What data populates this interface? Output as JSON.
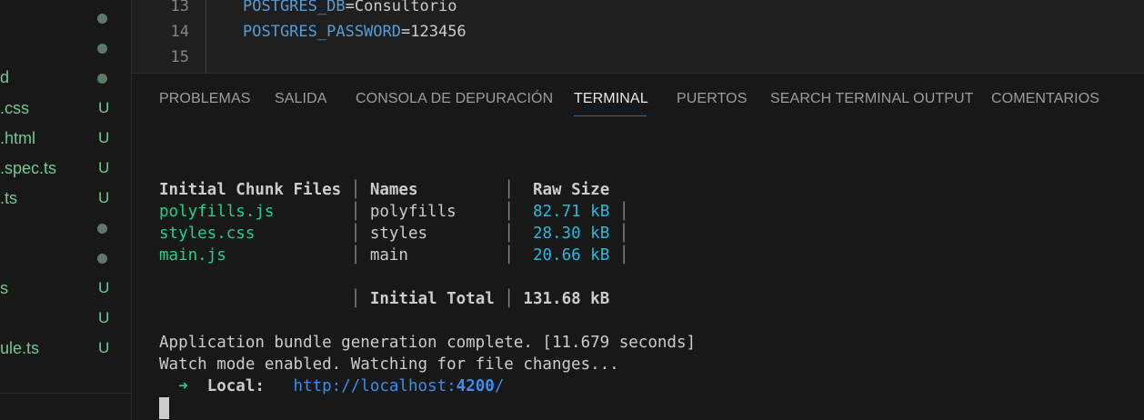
{
  "sidebar": {
    "items": [
      {
        "name": "",
        "status": "dot"
      },
      {
        "name": "",
        "status": "dot"
      },
      {
        "name": "d",
        "status": "dot"
      },
      {
        "name": ".css",
        "status": "U"
      },
      {
        "name": ".html",
        "status": "U"
      },
      {
        "name": ".spec.ts",
        "status": "U"
      },
      {
        "name": ".ts",
        "status": "U"
      },
      {
        "name": "",
        "status": "dot"
      },
      {
        "name": "",
        "status": "dot"
      },
      {
        "name": "s",
        "status": "U"
      },
      {
        "name": "",
        "status": "U"
      },
      {
        "name": "ule.ts",
        "status": "U"
      }
    ]
  },
  "editor": {
    "lines": [
      {
        "num": "13",
        "key": "POSTGRES_DB",
        "eq": "=",
        "val": "Consultorio"
      },
      {
        "num": "14",
        "key": "POSTGRES_PASSWORD",
        "eq": "=",
        "val": "123456"
      },
      {
        "num": "15",
        "key": "",
        "eq": "",
        "val": ""
      }
    ]
  },
  "panel": {
    "tabs": [
      {
        "label": "PROBLEMAS",
        "active": false
      },
      {
        "label": "SALIDA",
        "active": false
      },
      {
        "label": "CONSOLA DE DEPURACIÓN",
        "active": false
      },
      {
        "label": "TERMINAL",
        "active": true
      },
      {
        "label": "PUERTOS",
        "active": false
      },
      {
        "label": "SEARCH TERMINAL OUTPUT",
        "active": false
      },
      {
        "label": "COMENTARIOS",
        "active": false
      }
    ]
  },
  "terminal": {
    "header": {
      "files": "Initial Chunk Files",
      "names": "Names",
      "raw": "Raw Size"
    },
    "rows": [
      {
        "file": "polyfills.js",
        "name": "polyfills",
        "size": "82.71 kB"
      },
      {
        "file": "styles.css",
        "name": "styles",
        "size": "28.30 kB"
      },
      {
        "file": "main.js",
        "name": "main",
        "size": "20.66 kB"
      }
    ],
    "total": {
      "label": "Initial Total",
      "size": "131.68 kB"
    },
    "complete_msg": "Application bundle generation complete. [11.679 seconds]",
    "watch_msg": "Watch mode enabled. Watching for file changes...",
    "local": {
      "arrow": "➜",
      "label": "Local:",
      "url_prefix": "http://localhost:",
      "port": "4200",
      "url_suffix": "/"
    }
  },
  "colors": {
    "accent": "#0078d4",
    "git_untracked": "#73c991",
    "terminal_green": "#23d18b",
    "terminal_cyan": "#29b8db"
  }
}
